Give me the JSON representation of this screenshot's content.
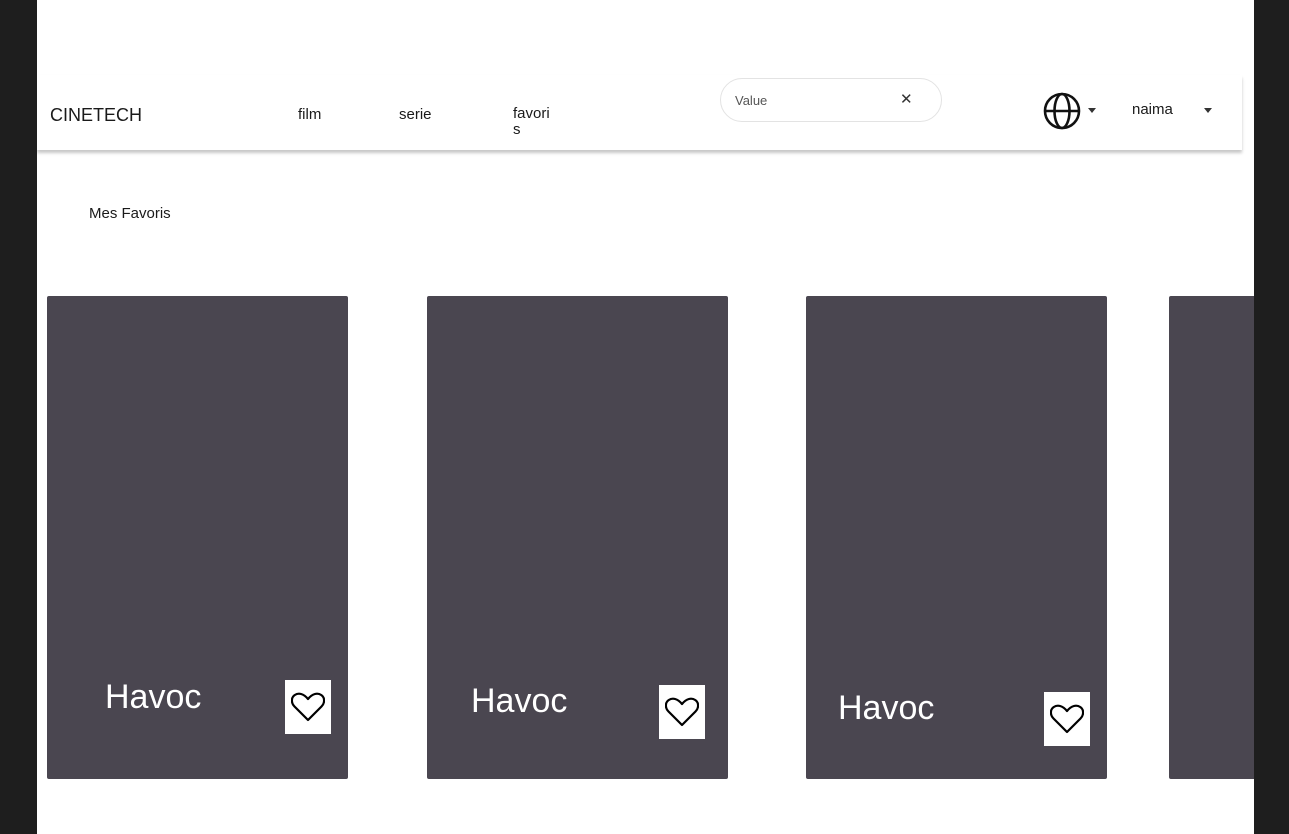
{
  "navbar": {
    "logo": "CINETECH",
    "links": [
      {
        "label": "film"
      },
      {
        "label": "serie"
      },
      {
        "label": "favoris"
      }
    ],
    "search": {
      "value": "",
      "placeholder": "Value",
      "clear_icon": "close-icon"
    },
    "language": {
      "icon": "globe-icon"
    },
    "user": {
      "name": "naima"
    }
  },
  "main": {
    "title": "Mes Favoris",
    "cards": [
      {
        "title": "Havoc",
        "favorite": true
      },
      {
        "title": "Havoc",
        "favorite": true
      },
      {
        "title": "Havoc",
        "favorite": true
      },
      {
        "title": "",
        "favorite": false
      }
    ]
  },
  "colors": {
    "card_background": "#4a4650",
    "outer_background": "#1e1e1e",
    "page_background": "#ffffff"
  }
}
